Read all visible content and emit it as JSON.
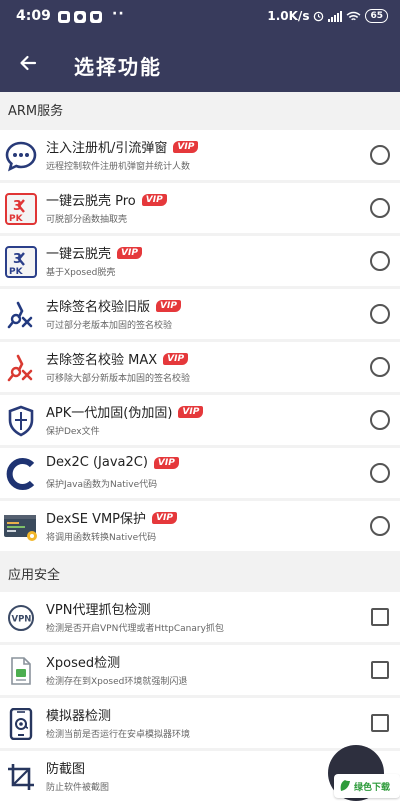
{
  "status_bar": {
    "time": "4:09",
    "dots": "··",
    "net_speed": "1.0K/s",
    "battery": "65"
  },
  "toolbar": {
    "title": "选择功能",
    "back_icon": "back-arrow-icon"
  },
  "sections": [
    {
      "title": "ARM服务",
      "items": [
        {
          "title": "注入注册机/引流弹窗",
          "desc": "远程控制软件注册机弹窗并统计人数",
          "vip": "VIP",
          "icon": "chat-bubble-icon"
        },
        {
          "title": "一键云脱壳 Pro",
          "desc": "可脱部分函数抽取壳",
          "vip": "VIP",
          "icon": "unpack-pro-icon"
        },
        {
          "title": "一键云脱壳",
          "desc": "基于Xposed脱壳",
          "vip": "VIP",
          "icon": "unpack-icon"
        },
        {
          "title": "去除签名校验旧版",
          "desc": "可过部分老版本加固的签名校验",
          "vip": "VIP",
          "icon": "pen-tool-icon"
        },
        {
          "title": "去除签名校验 MAX",
          "desc": "可移除大部分新版本加固的签名校验",
          "vip": "VIP",
          "icon": "pen-tool-red-icon"
        },
        {
          "title": "APK一代加固(伪加固)",
          "desc": "保护Dex文件",
          "vip": "VIP",
          "icon": "shield-icon"
        },
        {
          "title": "Dex2C (Java2C)",
          "desc": "保护Java函数为Native代码",
          "vip": "VIP",
          "icon": "letter-c-icon"
        },
        {
          "title": "DexSE VMP保护",
          "desc": "将调用函数转换Native代码",
          "vip": "VIP",
          "icon": "code-screen-icon"
        }
      ]
    },
    {
      "title": "应用安全",
      "items": [
        {
          "title": "VPN代理抓包检测",
          "desc": "检测是否开启VPN代理或者HttpCanary抓包",
          "icon": "vpn-icon"
        },
        {
          "title": "Xposed检测",
          "desc": "检测存在到Xposed环境就强制闪退",
          "icon": "document-icon"
        },
        {
          "title": "模拟器检测",
          "desc": "检测当前是否运行在安卓模拟器环境",
          "icon": "phone-at-icon"
        },
        {
          "title": "防截图",
          "desc": "防止软件被截图",
          "icon": "crop-icon"
        }
      ]
    }
  ],
  "watermark": {
    "text": "绿色下载"
  }
}
